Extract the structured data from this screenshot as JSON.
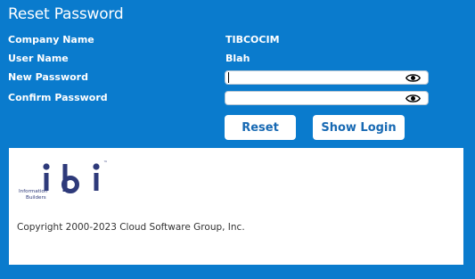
{
  "page": {
    "title": "Reset Password"
  },
  "form": {
    "company_label": "Company Name",
    "company_value": "TIBCOCIM",
    "user_label": "User Name",
    "user_value": "Blah",
    "new_password_label": "New Password",
    "confirm_password_label": "Confirm Password",
    "new_password_value": "",
    "confirm_password_value": ""
  },
  "buttons": {
    "reset": "Reset",
    "show_login": "Show Login"
  },
  "footer": {
    "logo_text_line1": "Information",
    "logo_text_line2": "Builders",
    "logo_tm": "™",
    "copyright": "Copyright 2000-2023 Cloud Software Group, Inc."
  },
  "colors": {
    "background": "#0a7bcd",
    "button_text": "#1769b3",
    "logo": "#2e3a7a"
  },
  "icons": {
    "show_password": "eye-icon"
  }
}
